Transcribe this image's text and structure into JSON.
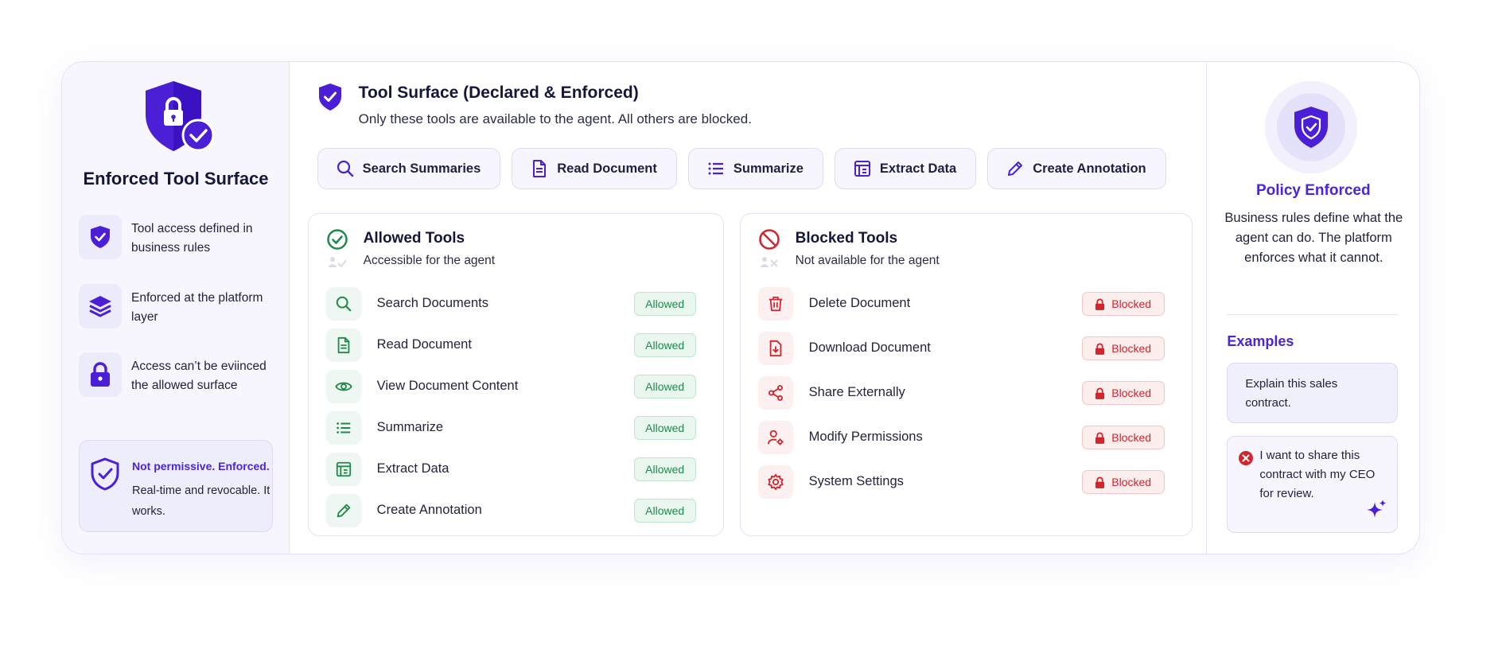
{
  "left": {
    "title": "Enforced Tool Surface",
    "features": [
      {
        "icon": "shield-check-icon",
        "text": "Tool access defined in business rules"
      },
      {
        "icon": "layers-icon",
        "text": "Enforced at the platform layer"
      },
      {
        "icon": "lock-icon",
        "text": "Access can’t be eviinced the allowed surface"
      }
    ],
    "note": {
      "headline": "Not permissive. Enforced.",
      "body": "Real-time and revocable. It works."
    }
  },
  "header": {
    "title": "Tool Surface (Declared & Enforced)",
    "subtitle": "Only these tools are available to the agent. All others are blocked."
  },
  "chips": [
    {
      "icon": "search-icon",
      "label": "Search Summaries"
    },
    {
      "icon": "document-icon",
      "label": "Read Document"
    },
    {
      "icon": "list-icon",
      "label": "Summarize"
    },
    {
      "icon": "table-icon",
      "label": "Extract Data"
    },
    {
      "icon": "pencil-icon",
      "label": "Create Annotation"
    }
  ],
  "allowed": {
    "title": "Allowed Tools",
    "subtitle": "Accessible for the agent",
    "badge": "Allowed",
    "items": [
      {
        "icon": "search-icon",
        "label": "Search Documents"
      },
      {
        "icon": "document-icon",
        "label": "Read Document"
      },
      {
        "icon": "eye-icon",
        "label": "View Document Content"
      },
      {
        "icon": "list-icon",
        "label": "Summarize"
      },
      {
        "icon": "table-icon",
        "label": "Extract Data"
      },
      {
        "icon": "pencil-icon",
        "label": "Create Annotation"
      }
    ]
  },
  "blocked": {
    "title": "Blocked Tools",
    "subtitle": "Not available for the agent",
    "badge": "Blocked",
    "items": [
      {
        "icon": "trash-icon",
        "label": "Delete Document"
      },
      {
        "icon": "download-icon",
        "label": "Download Document"
      },
      {
        "icon": "share-icon",
        "label": "Share Externally"
      },
      {
        "icon": "user-gear-icon",
        "label": "Modify Permissions"
      },
      {
        "icon": "gear-icon",
        "label": "System Settings"
      }
    ]
  },
  "policy": {
    "title": "Policy Enforced",
    "text": "Business rules define what the agent can do. The platform enforces what it cannot."
  },
  "examples": {
    "title": "Examples",
    "allowed_example": "Explain this sales contract.",
    "blocked_example": "I want to share this contract with my CEO for review."
  },
  "colors": {
    "accent": "#4a25d9",
    "allowed": "#1f8a4a",
    "blocked": "#d1262e"
  }
}
